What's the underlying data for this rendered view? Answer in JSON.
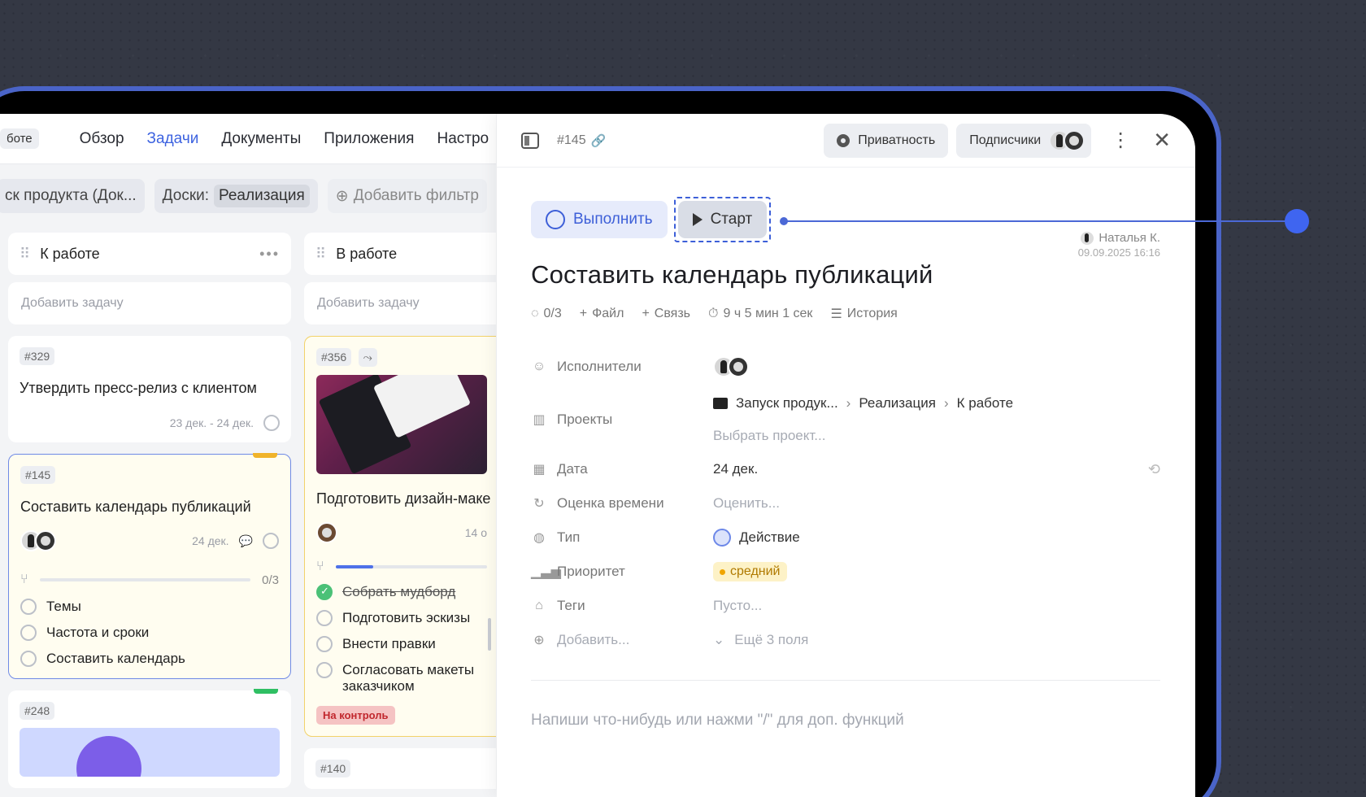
{
  "board": {
    "crumb_chip": "боте",
    "nav": [
      "Обзор",
      "Задачи",
      "Документы",
      "Приложения",
      "Настро"
    ],
    "filters": {
      "product": "ск продукта (Док...",
      "boards_label": "Доски:",
      "boards_value": "Реализация",
      "add_filter": "Добавить фильтр"
    },
    "columns": [
      {
        "title": "К работе",
        "add_task": "Добавить задачу",
        "cards": [
          {
            "id": "#329",
            "title": "Утвердить пресс-релиз с клиентом",
            "dates": "23 дек. - 24 дек."
          },
          {
            "id": "#145",
            "title": "Составить календарь публикаций",
            "dates": "24 дек.",
            "progress": "0/3",
            "progress_fraction": 0,
            "checklist": [
              "Темы",
              "Частота и сроки",
              "Составить календарь"
            ]
          },
          {
            "id": "#248"
          }
        ]
      },
      {
        "title": "В работе",
        "add_task": "Добавить задачу",
        "cards": [
          {
            "id": "#356",
            "title": "Подготовить дизайн-маке",
            "dates": "14 о",
            "progress_fraction": 0.25,
            "checklist": [
              {
                "text": "Собрать мудборд",
                "done": true
              },
              {
                "text": "Подготовить эскизы",
                "done": false
              },
              {
                "text": "Внести правки",
                "done": false
              },
              {
                "text": "Согласовать макеты заказчиком",
                "done": false
              }
            ],
            "badge": "На контроль"
          },
          {
            "id": "#140"
          }
        ]
      }
    ]
  },
  "panel": {
    "task_id": "#145",
    "privacy_label": "Приватность",
    "subscribers_label": "Подписчики",
    "complete_label": "Выполнить",
    "start_label": "Старт",
    "author_name": "Наталья К.",
    "author_date": "09.09.2025 16:16",
    "title": "Составить календарь публикаций",
    "meta": {
      "subtasks": "0/3",
      "file": "Файл",
      "link": "Связь",
      "time": "9 ч 5 мин 1 сек",
      "history": "История"
    },
    "props": {
      "assignees_label": "Исполнители",
      "projects_label": "Проекты",
      "project_path": [
        "Запуск продук...",
        "Реализация",
        "К работе"
      ],
      "choose_project": "Выбрать проект...",
      "date_label": "Дата",
      "date_value": "24 дек.",
      "estimate_label": "Оценка времени",
      "estimate_value": "Оценить...",
      "type_label": "Тип",
      "type_value": "Действие",
      "priority_label": "Приоритет",
      "priority_value": "средний",
      "tags_label": "Теги",
      "tags_value": "Пусто...",
      "add_label": "Добавить...",
      "more_fields": "Ещё 3 поля"
    },
    "comment_placeholder": "Напиши что-нибудь или нажми \"/\" для доп. функций"
  },
  "colors": {
    "accent": "#3d63e0",
    "priority": "#f0a500",
    "done": "#4bc177"
  }
}
